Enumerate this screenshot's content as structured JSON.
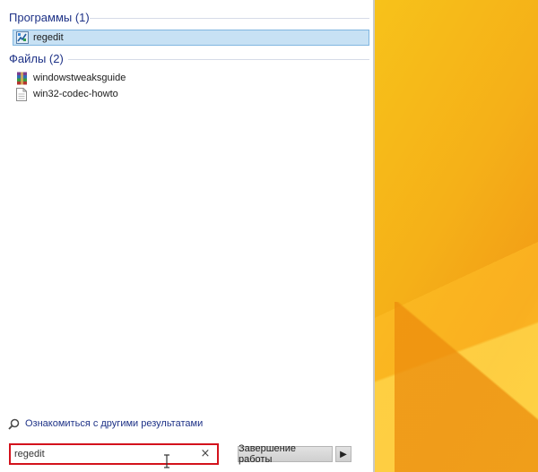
{
  "groups": {
    "programs": {
      "title": "Программы (1)",
      "items": [
        {
          "label": "regedit",
          "icon": "regedit-icon",
          "selected": true
        }
      ]
    },
    "files": {
      "title": "Файлы (2)",
      "items": [
        {
          "label": "windowstweaksguide",
          "icon": "winrar-archive-icon"
        },
        {
          "label": "win32-codec-howto",
          "icon": "text-document-icon"
        }
      ]
    }
  },
  "more_results": {
    "label": "Ознакомиться с другими результатами",
    "icon": "search-icon"
  },
  "search": {
    "value": "regedit",
    "clear_label": "×"
  },
  "shutdown": {
    "label": "Завершение работы",
    "arrow": "▶"
  },
  "colors": {
    "accent_title": "#1e3287",
    "selection_bg": "#c7e1f4",
    "highlight_border": "#d3121c",
    "desktop": "#f5a623"
  }
}
